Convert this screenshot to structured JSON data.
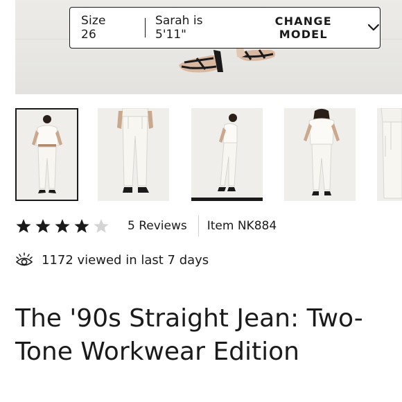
{
  "size_bar": {
    "size_label": "Size 26",
    "model_label": "Sarah is 5'11\"",
    "change_model_label": "CHANGE MODEL"
  },
  "thumbnails": [
    {
      "name": "view-front-outfit",
      "selected": true
    },
    {
      "name": "view-front-closeup",
      "selected": false
    },
    {
      "name": "view-side",
      "selected": false
    },
    {
      "name": "view-back",
      "selected": false
    },
    {
      "name": "view-detail",
      "selected": false
    }
  ],
  "rating": {
    "value": 4,
    "max": 5,
    "reviews_label": "5 Reviews",
    "item_label": "Item NK884"
  },
  "viewed": {
    "icon": "eye-icon",
    "text": "1172 viewed in last 7 days"
  },
  "product": {
    "title_line1": "The '90s Straight Jean: Two-",
    "title_line2": "Tone Workwear Edition"
  },
  "colors": {
    "text": "#1a1a1a",
    "star_filled": "#1a1a1a",
    "star_empty": "#d4d4d4",
    "image_bg": "#efeeea"
  }
}
